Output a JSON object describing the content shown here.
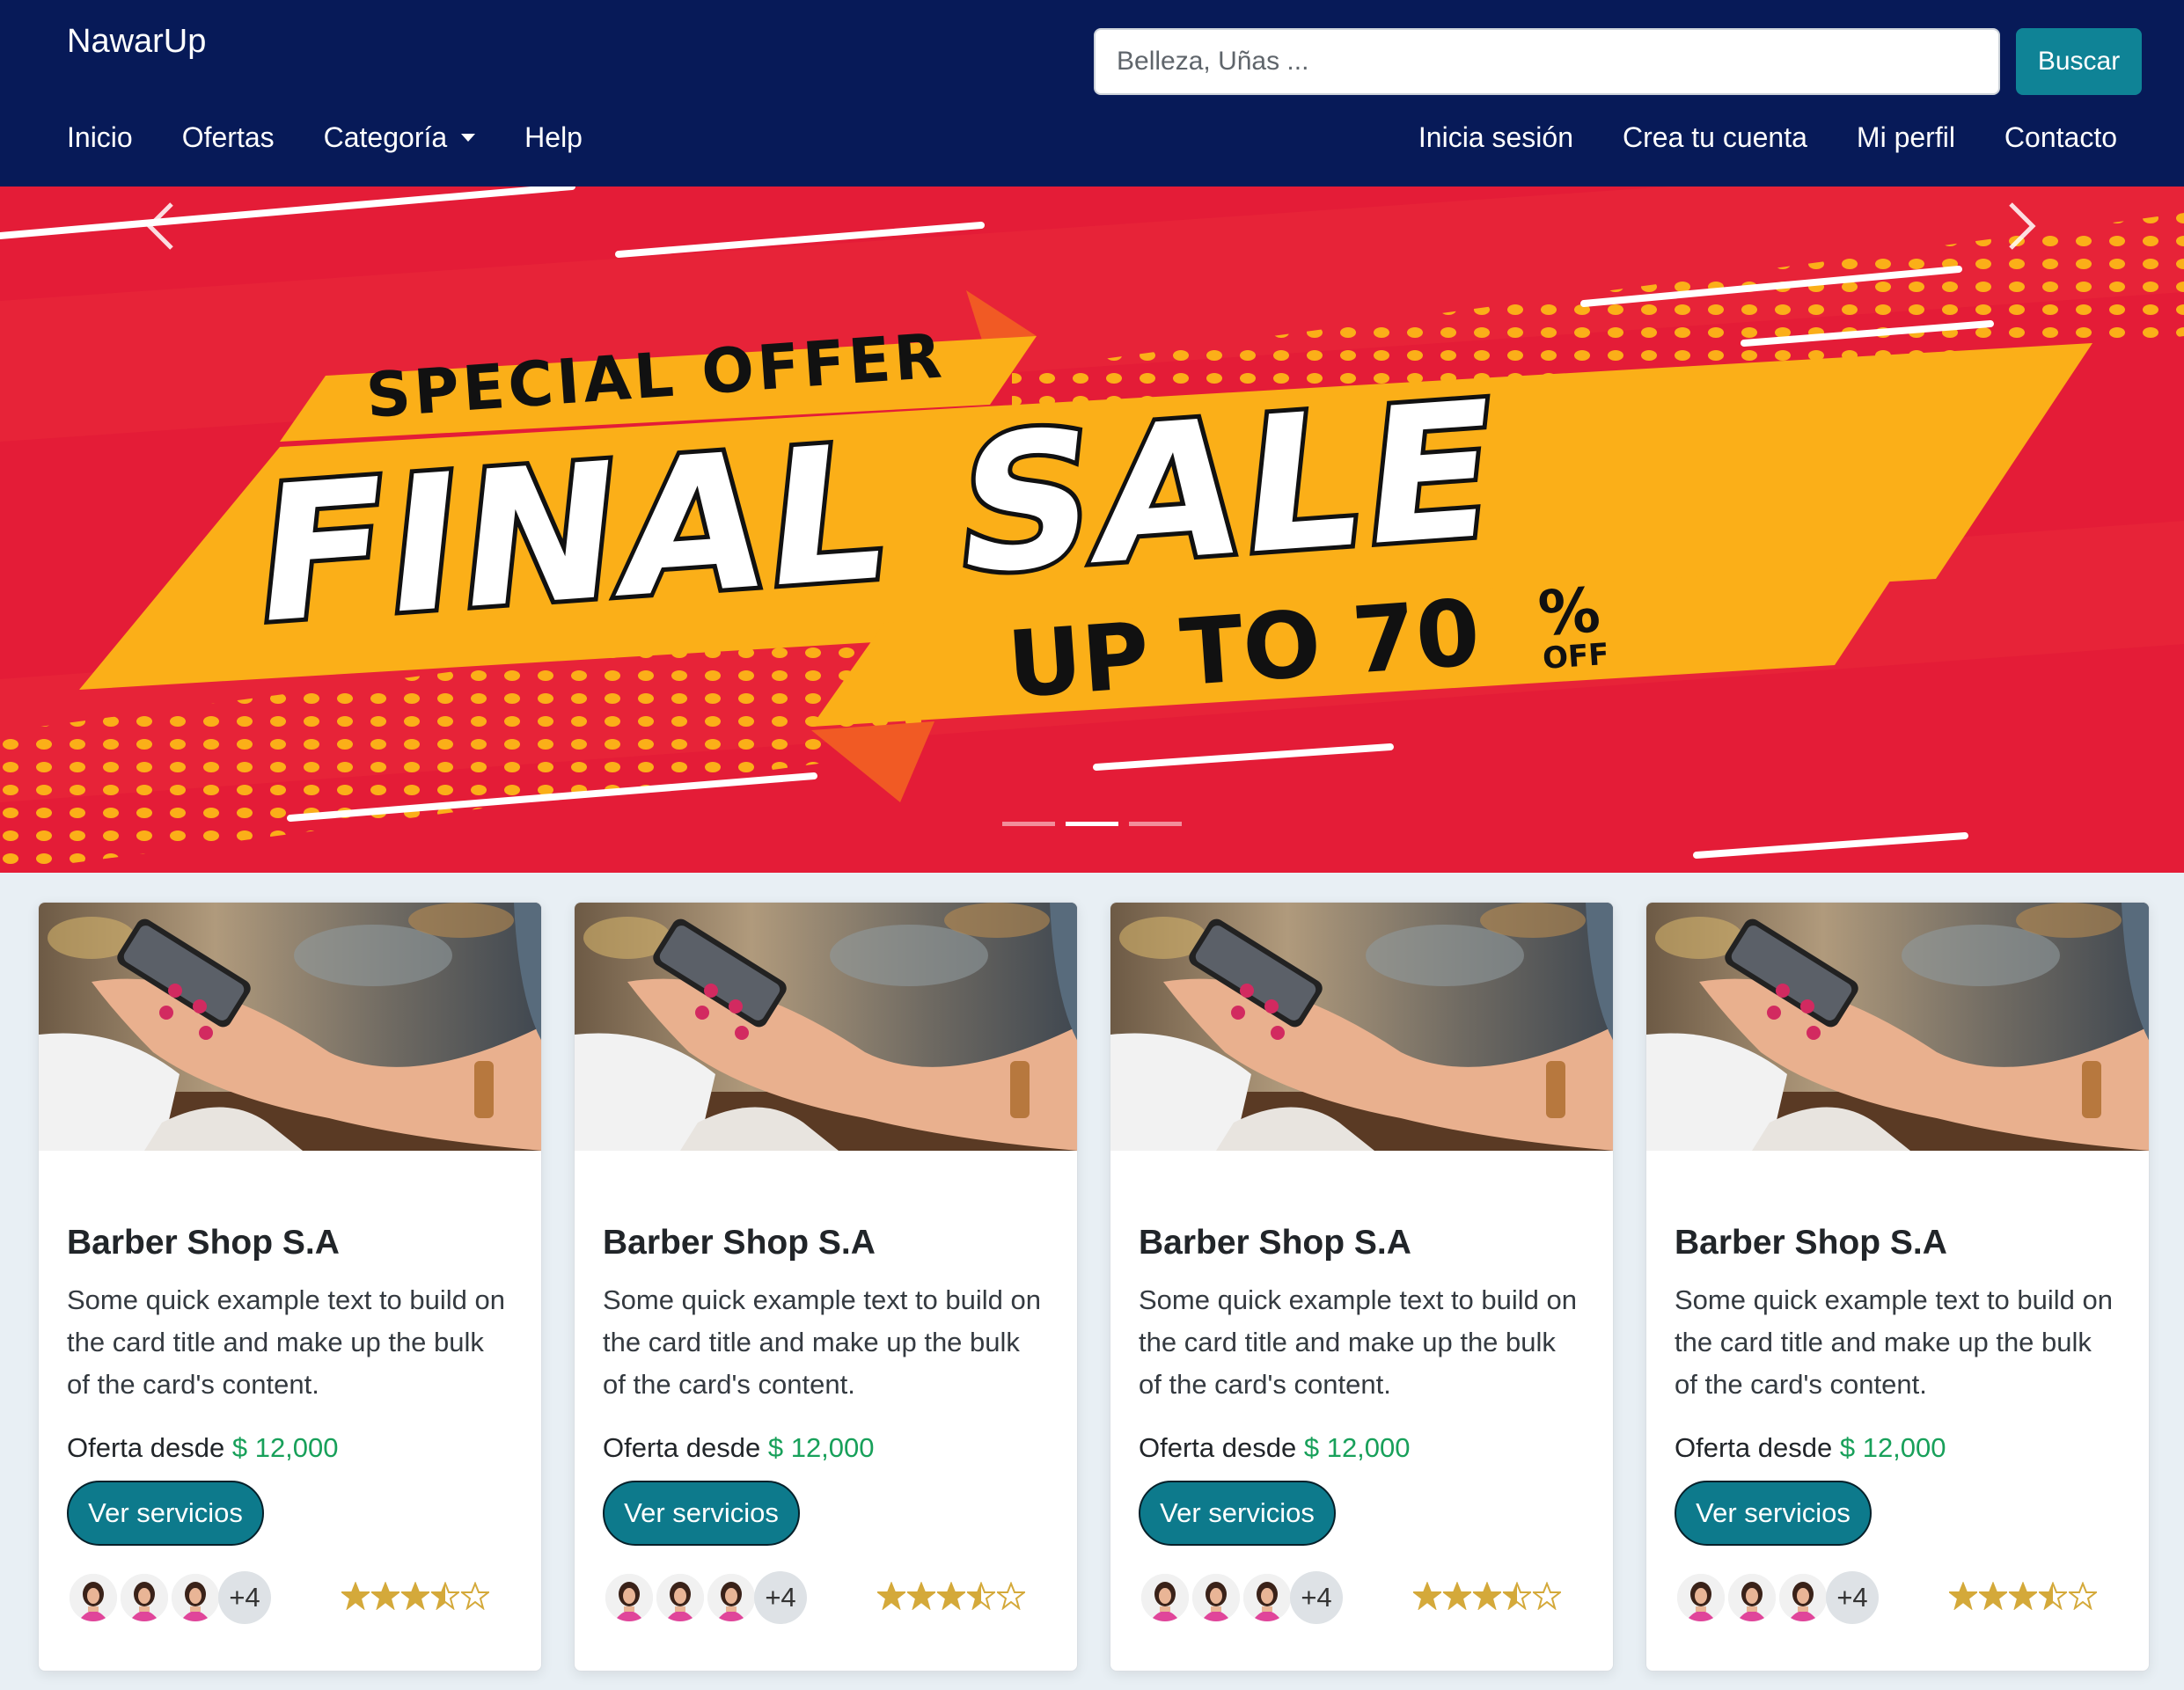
{
  "brand": "NawarUp",
  "search": {
    "placeholder": "Belleza, Uñas ...",
    "button_label": "Buscar"
  },
  "nav_left": [
    "Inicio",
    "Ofertas",
    "Categoría",
    "Help"
  ],
  "nav_right": [
    "Inicia sesión",
    "Crea tu cuenta",
    "Mi perfil",
    "Contacto"
  ],
  "banner": {
    "line1": "SPECIAL OFFER",
    "line2": "FINAL SALE",
    "line3": "UP TO 70",
    "percent": "%",
    "off": "OFF",
    "slides": 3,
    "active_slide": 2
  },
  "colors": {
    "navbar_bg": "#071a58",
    "banner_red": "#e41c37",
    "banner_yellow": "#fbaf18",
    "accent_teal": "#0d7a8c",
    "price_green": "#18a05a",
    "star_gold": "#d4a93a"
  },
  "cards": [
    {
      "title": "Barber Shop S.A",
      "text": "Some quick example text to build on the card title and make up the bulk of the card's content.",
      "offer_label": "Oferta desde",
      "price": "$ 12,000",
      "button": "Ver servicios",
      "more_count": "+4",
      "rating": 3.5
    },
    {
      "title": "Barber Shop S.A",
      "text": "Some quick example text to build on the card title and make up the bulk of the card's content.",
      "offer_label": "Oferta desde",
      "price": "$ 12,000",
      "button": "Ver servicios",
      "more_count": "+4",
      "rating": 3.5
    },
    {
      "title": "Barber Shop S.A",
      "text": "Some quick example text to build on the card title and make up the bulk of the card's content.",
      "offer_label": "Oferta desde",
      "price": "$ 12,000",
      "button": "Ver servicios",
      "more_count": "+4",
      "rating": 3.5
    },
    {
      "title": "Barber Shop S.A",
      "text": "Some quick example text to build on the card title and make up the bulk of the card's content.",
      "offer_label": "Oferta desde",
      "price": "$ 12,000",
      "button": "Ver servicios",
      "more_count": "+4",
      "rating": 3.5
    }
  ]
}
